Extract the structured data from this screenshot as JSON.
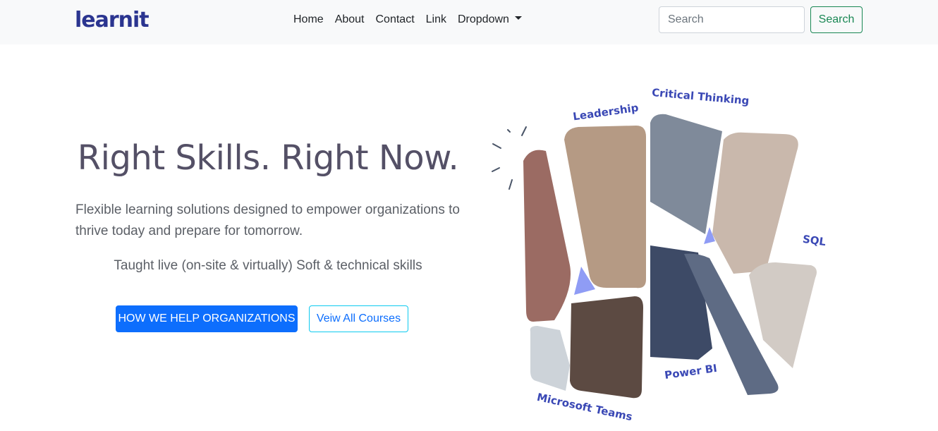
{
  "navbar": {
    "logo": "learnit",
    "links": [
      "Home",
      "About",
      "Contact",
      "Link",
      "Dropdown"
    ],
    "search_placeholder": "Search",
    "search_button": "Search"
  },
  "hero": {
    "title": "Right Skills. Right Now.",
    "subtitle": "Flexible learning solutions designed to empower organizations to thrive today and prepare for tomorrow.",
    "taught": "Taught live (on-site & virtually) Soft & technical skills",
    "primary_button": "HOW WE HELP ORGANIZATIONS",
    "secondary_button": "Veiw All Courses"
  },
  "collage": {
    "labels": {
      "leadership": "Leadership",
      "critical_thinking": "Critical Thinking",
      "sql": "SQL",
      "power_bi": "Power BI",
      "microsoft_teams": "Microsoft Teams"
    },
    "accent_color": "#8f9cf5",
    "label_color": "#3a48b5"
  },
  "colors": {
    "brand": "#2b3590",
    "primary": "#0d6efd",
    "success": "#198754",
    "navbar_bg": "#f8f9fa"
  }
}
